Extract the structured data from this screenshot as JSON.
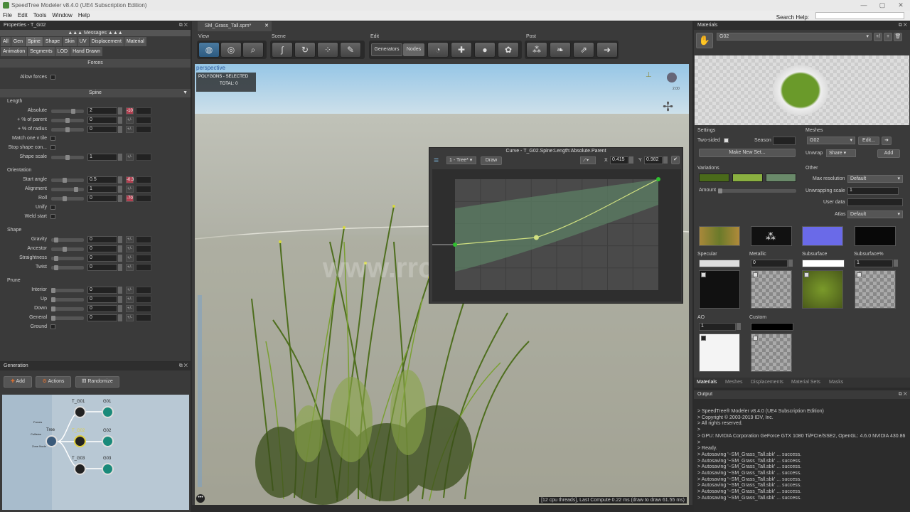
{
  "window": {
    "title": "SpeedTree Modeler v8.4.0 (UE4 Subscription Edition)",
    "min": "—",
    "max": "▢",
    "close": "✕"
  },
  "menu": [
    "File",
    "Edit",
    "Tools",
    "Window",
    "Help"
  ],
  "search": {
    "label": "Search Help:",
    "placeholder": ""
  },
  "watermark": "www.rrcg.cn",
  "properties": {
    "title": "Properties - T_G02",
    "messages": "Messages",
    "tabs_row1": [
      "All",
      "Gen",
      "Spine",
      "Shape",
      "Skin",
      "UV",
      "Displacement",
      "Material"
    ],
    "tabs_row2": [
      "Animation",
      "Segments",
      "LOD",
      "Hand Drawn"
    ],
    "forces_header": "Forces",
    "allow_forces": "Allow forces",
    "spine_header": "Spine",
    "length_group": "Length",
    "length_rows": [
      {
        "label": "Absolute",
        "value": "2",
        "pm": "-10"
      },
      {
        "label": "+ % of parent",
        "value": "0",
        "pm": "+/-"
      },
      {
        "label": "+ % of radius",
        "value": "0",
        "pm": "+/-"
      }
    ],
    "match_one": "Match one v tile",
    "stop_shape": "Stop shape con...",
    "shape_scale": {
      "label": "Shape scale",
      "value": "1",
      "pm": "+/-"
    },
    "orientation_group": "Orientation",
    "orient_rows": [
      {
        "label": "Start angle",
        "value": "0.5",
        "pm": "-0.3"
      },
      {
        "label": "Alignment",
        "value": "1",
        "pm": "+/-"
      },
      {
        "label": "Roll",
        "value": "0",
        "pm": "-70"
      }
    ],
    "unify": "Unify",
    "weld_start": "Weld start",
    "shape_group": "Shape",
    "shape_rows": [
      {
        "label": "Gravity",
        "value": "0",
        "pm": "+/-"
      },
      {
        "label": "Ancestor",
        "value": "0",
        "pm": "+/-"
      },
      {
        "label": "Straightness",
        "value": "0",
        "pm": "+/-"
      },
      {
        "label": "Twist",
        "value": "0",
        "pm": "+/-"
      }
    ],
    "prune_group": "Prune",
    "prune_rows": [
      {
        "label": "Interior",
        "value": "0",
        "pm": "+/-"
      },
      {
        "label": "Up",
        "value": "0",
        "pm": "+/-"
      },
      {
        "label": "Down",
        "value": "0",
        "pm": "+/-"
      },
      {
        "label": "General",
        "value": "0",
        "pm": "+/-"
      }
    ],
    "ground": "Ground"
  },
  "generation": {
    "title": "Generation",
    "buttons": [
      "Add",
      "Actions",
      "Randomize"
    ],
    "nodes": {
      "tree": "Tree",
      "tg01": "T_G01",
      "tg02": "T_G02",
      "tg03": "T_G03",
      "g01": "G01",
      "g02": "G02",
      "g03": "G03",
      "forces": "Forces",
      "collision": "Collision",
      "zone": "Zone Node"
    }
  },
  "viewport": {
    "tab": "SM_Grass_Tall.spm*",
    "groups": [
      "View",
      "Scene",
      "Edit",
      "Post"
    ],
    "edit_tabs": [
      "Generators",
      "Nodes"
    ],
    "perspective": "perspective",
    "sel_title": "POLYGONS - SELECTED",
    "sel_total": "TOTAL:  0",
    "status": "[12 cpu threads], Last Compute 0.22 ms (draw to draw 61.55 ms)",
    "zoom": "2.00"
  },
  "curve": {
    "title": "Curve - T_G02.Spine:Length:Absolute.Parent",
    "source": "1 - Tree*",
    "draw": "Draw",
    "x": "0.415",
    "y": "0.982",
    "points": [
      [
        0,
        0.05
      ],
      [
        0.4,
        0.12
      ],
      [
        1,
        1
      ]
    ]
  },
  "materials": {
    "title": "Materials",
    "name": "G02",
    "settings": "Settings",
    "two_sided": "Two-sided",
    "season": "Season",
    "make_new_set": "Make New Set...",
    "meshes": "Meshes",
    "mesh_sel": "G02",
    "edit": "Edit...",
    "unwrap": "Unwrap",
    "share": "Share",
    "add": "Add",
    "variations": "Variations",
    "amount": "Amount",
    "other": "Other",
    "max_res": "Max resolution",
    "max_res_val": "Default",
    "unwrap_scale": "Unwrapping scale",
    "unwrap_scale_val": "1",
    "user_data": "User data",
    "atlas": "Atlas",
    "atlas_val": "Default",
    "specular": "Specular",
    "metallic": "Metallic",
    "metallic_val": "0",
    "subsurface": "Subsurface",
    "subsurface_pct": "Subsurface%",
    "subsurface_pct_val": "1",
    "ao": "AO",
    "ao_val": "1",
    "custom": "Custom",
    "bottom_tabs": [
      "Materials",
      "Meshes",
      "Displacements",
      "Material Sets",
      "Masks"
    ],
    "variation_colors": [
      "#4a6a1a",
      "#8ab040",
      "#6a8a6a"
    ]
  },
  "output": {
    "title": "Output",
    "lines": [
      "> SpeedTree® Modeler v8.4.0 (UE4 Subscription Edition)",
      "> Copyright © 2003-2019 IDV, Inc.",
      "> All rights reserved.",
      ">",
      "> GPU: NVIDIA Corporation GeForce GTX 1080 Ti/PCIe/SSE2, OpenGL: 4.6.0 NVIDIA 430.86",
      ">",
      "> Ready.",
      "> Autosaving '~SM_Grass_Tall.sbk' ... success.",
      "> Autosaving '~SM_Grass_Tall.sbk' ... success.",
      "> Autosaving '~SM_Grass_Tall.sbk' ... success.",
      "> Autosaving '~SM_Grass_Tall.sbk' ... success.",
      "> Autosaving '~SM_Grass_Tall.sbk' ... success.",
      "> Autosaving '~SM_Grass_Tall.sbk' ... success.",
      "> Autosaving '~SM_Grass_Tall.sbk' ... success.",
      "> Autosaving '~SM_Grass_Tall.sbk' ... success."
    ]
  }
}
